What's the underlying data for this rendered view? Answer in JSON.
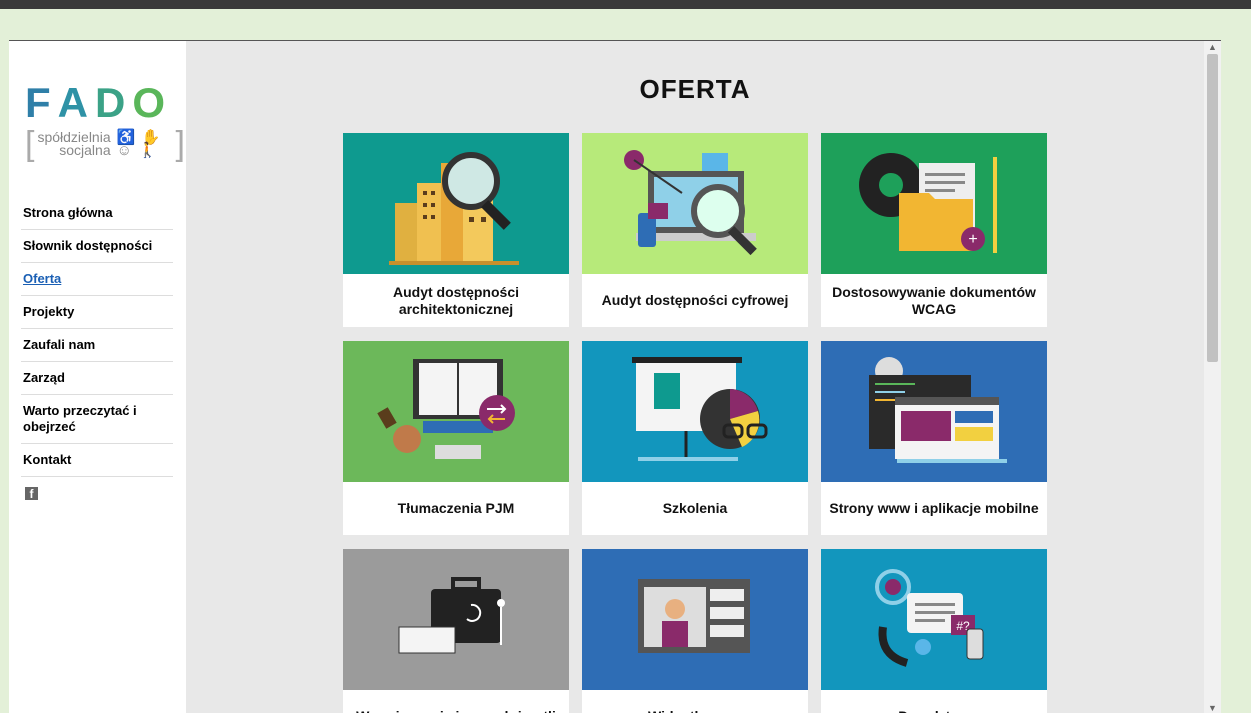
{
  "brand": {
    "letters": [
      "F",
      "A",
      "D",
      "O"
    ],
    "letter_colors": [
      "#2f7fa8",
      "#2f92a6",
      "#3ba287",
      "#5ab65a"
    ],
    "sub_line1": "spółdzielnia",
    "sub_line2": "socjalna",
    "glyphs": "♿ ✋ ☺ 🚶"
  },
  "nav": {
    "items": [
      {
        "label": "Strona główna",
        "active": false
      },
      {
        "label": "Słownik dostępności",
        "active": false
      },
      {
        "label": "Oferta",
        "active": true
      },
      {
        "label": "Projekty",
        "active": false
      },
      {
        "label": "Zaufali nam",
        "active": false
      },
      {
        "label": "Zarząd",
        "active": false
      },
      {
        "label": "Warto przeczytać i obejrzeć",
        "active": false
      },
      {
        "label": "Kontakt",
        "active": false
      }
    ],
    "facebook_icon": "facebook-icon",
    "facebook_glyph": "f"
  },
  "page": {
    "title": "OFERTA"
  },
  "cards": [
    {
      "label": "Audyt dostępności architektonicznej",
      "color": "#0e9a8f",
      "icon": "building-magnifier-icon"
    },
    {
      "label": "Audyt dostępności cyfrowej",
      "color": "#b7ea7a",
      "icon": "laptop-magnifier-icon"
    },
    {
      "label": "Dostosowywanie dokumentów WCAG",
      "color": "#1ea05a",
      "icon": "folder-gear-icon"
    },
    {
      "label": "Tłumaczenia PJM",
      "color": "#6cb85a",
      "icon": "book-computer-icon"
    },
    {
      "label": "Szkolenia",
      "color": "#1296bd",
      "icon": "presentation-board-icon"
    },
    {
      "label": "Strony www i aplikacje mobilne",
      "color": "#2e6db5",
      "icon": "code-browser-icon"
    },
    {
      "label": "Wypożyczenie i sprzedaż pętli",
      "color": "#9b9b9b",
      "icon": "briefcase-hearing-icon"
    },
    {
      "label": "Wideotłumacz",
      "color": "#2e6db5",
      "icon": "video-interpreter-icon"
    },
    {
      "label": "Doradztwo",
      "color": "#1296bd",
      "icon": "chat-phone-icon"
    }
  ],
  "scrollbar": {
    "up": "▲",
    "down": "▼"
  }
}
